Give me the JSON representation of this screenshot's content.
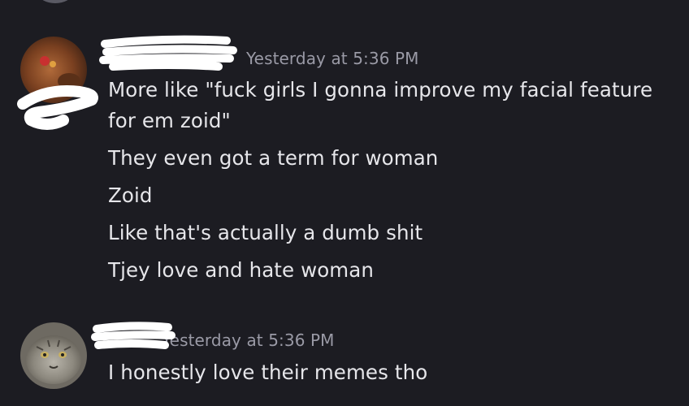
{
  "messages": [
    {
      "timestamp": "Yesterday at 5:36 PM",
      "avatar_icon": "user-avatar-icon",
      "lines": [
        "More like \"fuck girls I gonna improve my facial feature for em zoid\"",
        "They even got a term for woman",
        "Zoid",
        "Like that's actually a dumb shit",
        "Tjey love and hate woman"
      ]
    },
    {
      "timestamp": "Yesterday at 5:36 PM",
      "avatar_icon": "cat-avatar-icon",
      "lines": [
        "I honestly love their memes tho"
      ]
    }
  ],
  "colors": {
    "background": "#1c1c22",
    "text": "#e6e6ea",
    "timestamp": "#9a9aa6",
    "redaction": "#ffffff"
  }
}
